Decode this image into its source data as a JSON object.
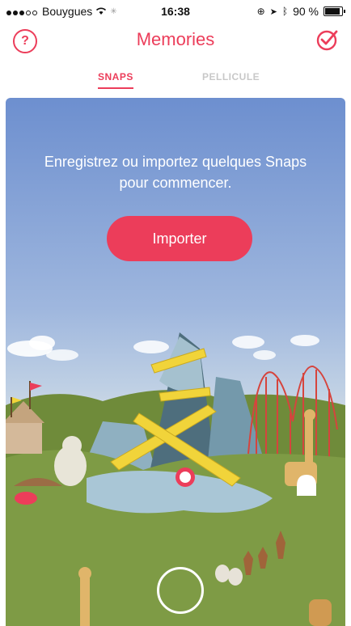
{
  "status_bar": {
    "carrier": "Bouygues",
    "time": "16:38",
    "battery": "90 %",
    "battery_level": 0.9
  },
  "header": {
    "title": "Memories",
    "help_icon": "question-circle-icon",
    "select_icon": "check-circle-icon"
  },
  "tabs": [
    {
      "label": "SNAPS",
      "active": true
    },
    {
      "label": "PELLICULE",
      "active": false
    }
  ],
  "empty_state": {
    "message": "Enregistrez ou importez quelques Snaps pour commencer.",
    "import_button": "Importer"
  },
  "colors": {
    "accent": "#ec3d5a",
    "sky_top": "#6d8fcf",
    "grass": "#7e9b45"
  }
}
